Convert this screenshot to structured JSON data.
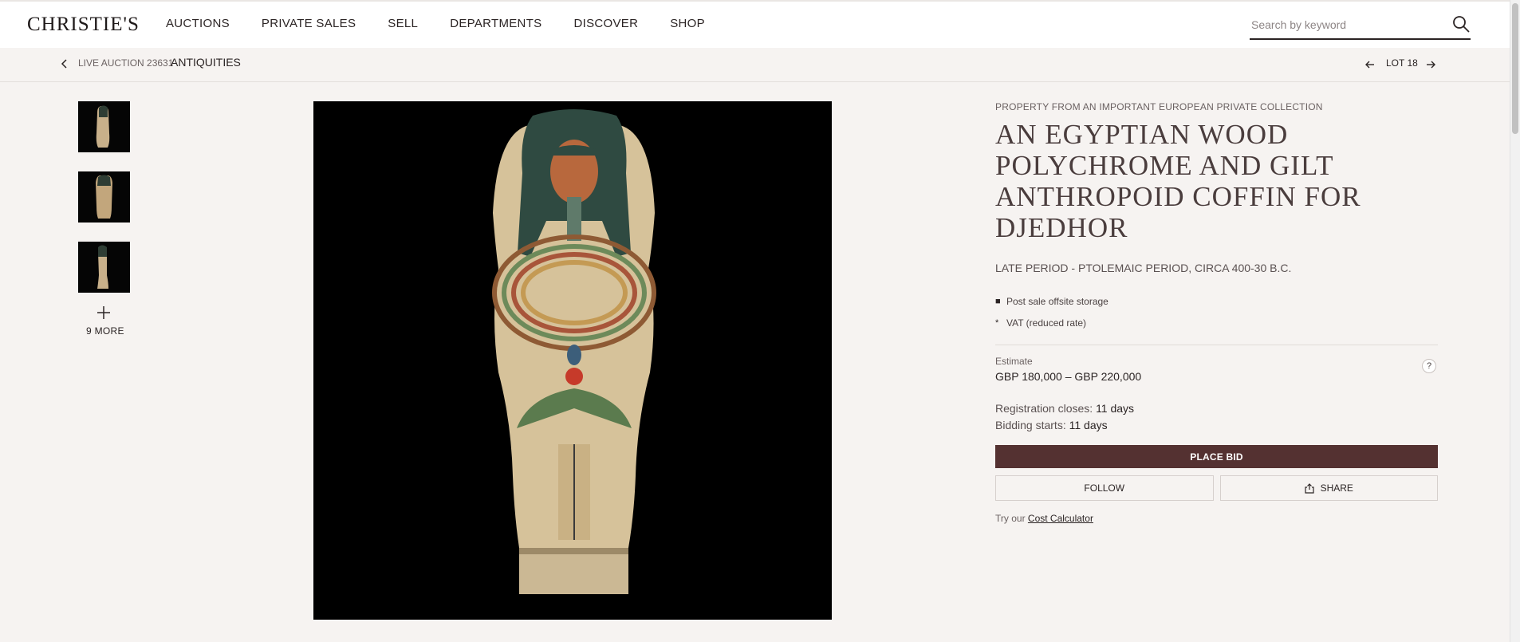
{
  "header": {
    "logo": "CHRISTIE'S",
    "nav": [
      "AUCTIONS",
      "PRIVATE SALES",
      "SELL",
      "DEPARTMENTS",
      "DISCOVER",
      "SHOP"
    ],
    "search_placeholder": "Search by keyword",
    "search_icon": "search-icon"
  },
  "breadcrumb": {
    "sale": "LIVE AUCTION 23631",
    "department": "ANTIQUITIES",
    "lot": "LOT 18"
  },
  "gallery": {
    "thumbnail_count": 3,
    "more_label": "9 MORE"
  },
  "lot": {
    "provenance": "PROPERTY FROM AN IMPORTANT EUROPEAN PRIVATE COLLECTION",
    "title": "AN EGYPTIAN WOOD POLYCHROME AND GILT ANTHROPOID COFFIN FOR DJEDHOR",
    "period": "LATE PERIOD - PTOLEMAIC PERIOD, CIRCA 400-30 B.C.",
    "symbols": [
      {
        "mark": "■",
        "text": "Post sale offsite storage"
      },
      {
        "mark": "*",
        "text": "VAT (reduced rate)"
      }
    ],
    "estimate_label": "Estimate",
    "estimate_value": "GBP 180,000 – GBP 220,000",
    "help": "?",
    "registration_label": "Registration closes:",
    "registration_value": "11 days",
    "bidding_label": "Bidding starts:",
    "bidding_value": "11 days",
    "place_bid": "PLACE BID",
    "follow": "FOLLOW",
    "share": "SHARE",
    "calc_prefix": "Try our",
    "calc_link": "Cost Calculator"
  },
  "colors": {
    "background": "#f6f3f1",
    "accent": "#543131",
    "text": "#2b2424"
  }
}
